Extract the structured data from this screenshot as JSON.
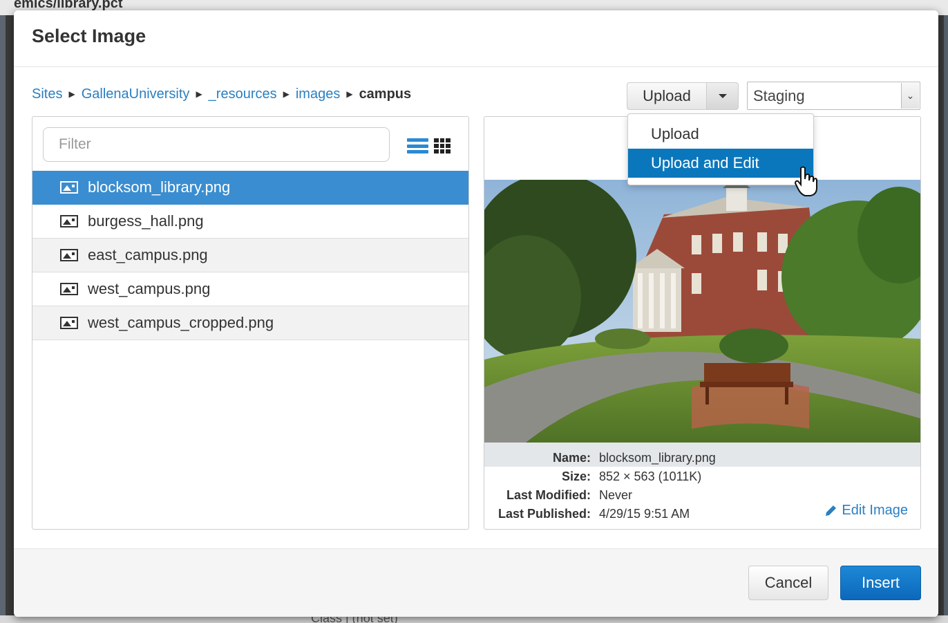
{
  "background": {
    "page_title": "emics/library.pct",
    "bottom_text": "Class  |  (not set)"
  },
  "modal": {
    "title": "Select Image"
  },
  "breadcrumb": {
    "items": [
      "Sites",
      "GallenaUniversity",
      "_resources",
      "images"
    ],
    "current": "campus"
  },
  "toolbar": {
    "upload_label": "Upload",
    "environment_value": "Staging",
    "dropdown": {
      "items": [
        "Upload",
        "Upload and Edit"
      ],
      "highlighted": "Upload and Edit"
    }
  },
  "filter": {
    "placeholder": "Filter"
  },
  "view_toggle": {
    "list_icon": "list-view-icon",
    "grid_icon": "grid-view-icon",
    "active": "list"
  },
  "files": [
    {
      "name": "blocksom_library.png",
      "selected": true
    },
    {
      "name": "burgess_hall.png",
      "selected": false
    },
    {
      "name": "east_campus.png",
      "selected": false
    },
    {
      "name": "west_campus.png",
      "selected": false
    },
    {
      "name": "west_campus_cropped.png",
      "selected": false
    }
  ],
  "details": {
    "name_label": "Name:",
    "name_value": "blocksom_library.png",
    "size_label": "Size:",
    "size_value": "852 × 563 (1011K)",
    "modified_label": "Last Modified:",
    "modified_value": "Never",
    "published_label": "Last Published:",
    "published_value": "4/29/15 9:51 AM",
    "edit_label": "Edit Image"
  },
  "footer": {
    "cancel_label": "Cancel",
    "insert_label": "Insert"
  },
  "colors": {
    "accent": "#3a8dd0",
    "link": "#2a7fc1",
    "primary_button": "#0c68ba",
    "menu_highlight": "#0a77bd"
  }
}
